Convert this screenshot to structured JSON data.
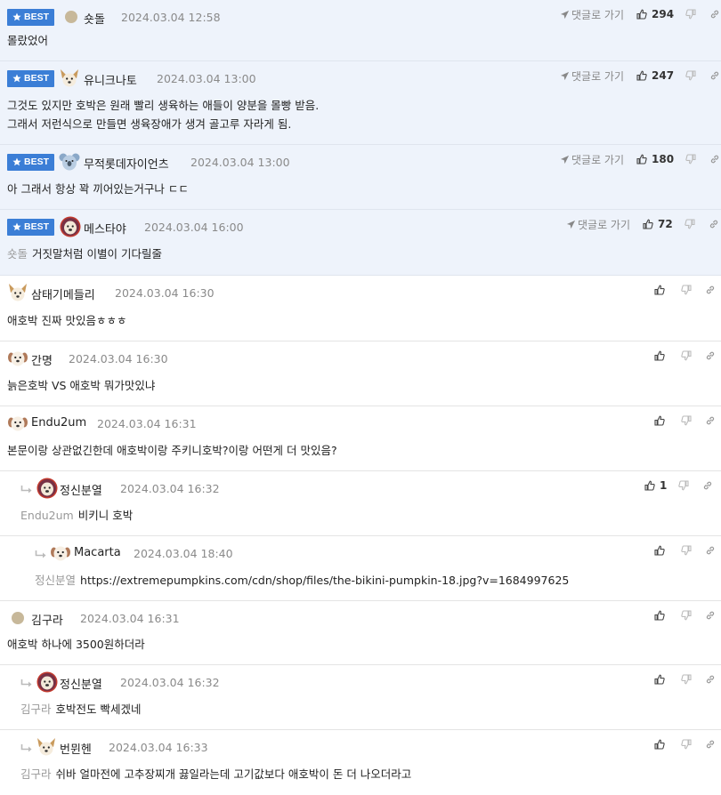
{
  "best_badge": "BEST",
  "reply_link_label": "댓글로 가기",
  "comments": [
    {
      "nick": "숏돌",
      "date": "2024.03.04 12:58",
      "lines": [
        "몰랐었어"
      ],
      "likes": "294",
      "mention": ""
    },
    {
      "nick": "유니크나토",
      "date": "2024.03.04 13:00",
      "lines": [
        "그것도 있지만 호박은 원래 빨리 생육하는 애들이 양분을 몰빵 받음.",
        "그래서 저런식으로 만들면 생육장애가 생겨 골고루 자라게 됨."
      ],
      "likes": "247",
      "mention": ""
    },
    {
      "nick": "무적롯데자이언츠",
      "date": "2024.03.04 13:00",
      "lines": [
        "아 그래서 항상 꽉 끼어있는거구나 ㄷㄷ"
      ],
      "likes": "180",
      "mention": ""
    },
    {
      "nick": "메스타야",
      "date": "2024.03.04 16:00",
      "lines": [
        "거짓말처럼 이별이 기다릴줄"
      ],
      "likes": "72",
      "mention": "숏돌"
    },
    {
      "nick": "삼태기메들리",
      "date": "2024.03.04 16:30",
      "lines": [
        "애호박 진짜 맛있음ㅎㅎㅎ"
      ],
      "likes": "",
      "mention": ""
    },
    {
      "nick": "간명",
      "date": "2024.03.04 16:30",
      "lines": [
        "늙은호박 VS 애호박 뭐가맛있냐"
      ],
      "likes": "",
      "mention": ""
    },
    {
      "nick": "Endu2um",
      "date": "2024.03.04 16:31",
      "lines": [
        "본문이랑 상관없긴한데 애호박이랑 주키니호박?이랑 어떤게 더 맛있음?"
      ],
      "likes": "",
      "mention": ""
    },
    {
      "nick": "정신분열",
      "date": "2024.03.04 16:32",
      "lines": [
        "비키니 호박"
      ],
      "likes": "1",
      "mention": "Endu2um"
    },
    {
      "nick": "Macarta",
      "date": "2024.03.04 18:40",
      "lines": [
        "https://extremepumpkins.com/cdn/shop/files/the-bikini-pumpkin-18.jpg?v=1684997625"
      ],
      "likes": "",
      "mention": "정신분열"
    },
    {
      "nick": "김구라",
      "date": "2024.03.04 16:31",
      "lines": [
        "애호박 하나에 3500원하더라"
      ],
      "likes": "",
      "mention": ""
    },
    {
      "nick": "정신분열",
      "date": "2024.03.04 16:32",
      "lines": [
        "호박전도 빡세겠네"
      ],
      "likes": "",
      "mention": "김구라"
    },
    {
      "nick": "번뮌헨",
      "date": "2024.03.04 16:33",
      "lines": [
        "쉬바 얼마전에 고추장찌개 끓일라는데 고기값보다 애호박이 돈 더 나오더라고"
      ],
      "likes": "",
      "mention": "김구라"
    }
  ],
  "colors": {
    "best_bg": "#eef3fb",
    "badge": "#3b7ed6",
    "meta": "#8a8a8a"
  },
  "icons": [
    "star-icon",
    "avatar-icon",
    "send-icon",
    "thumbs-up-icon",
    "thumbs-down-icon",
    "link-icon",
    "reply-arrow-icon"
  ]
}
